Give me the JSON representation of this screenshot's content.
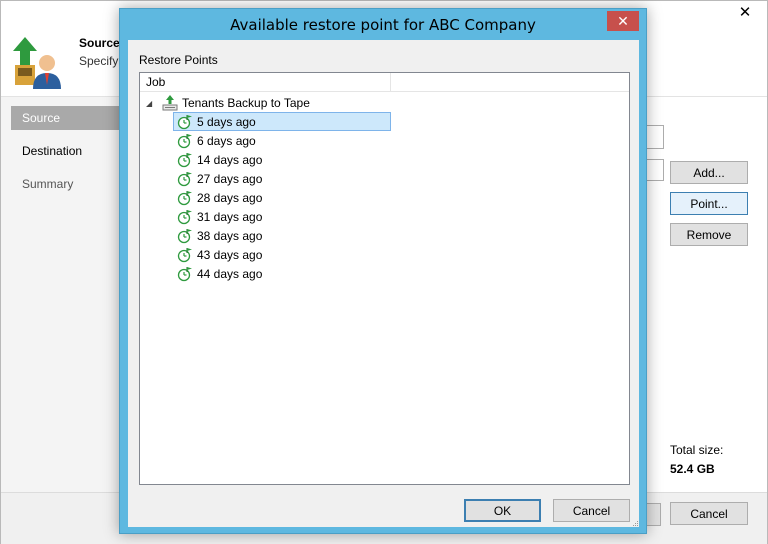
{
  "background": {
    "header_title": "Source",
    "header_subtitle": "Specify",
    "nav": [
      {
        "label": "Source",
        "state": "active"
      },
      {
        "label": "Destination",
        "state": "normal"
      },
      {
        "label": "Summary",
        "state": "dim"
      }
    ],
    "buttons": {
      "add": "Add...",
      "point": "Point...",
      "remove": "Remove",
      "cancel": "Cancel"
    },
    "total_size_label": "Total size:",
    "total_size_value": "52.4 GB",
    "close_glyph": "✕"
  },
  "dialog": {
    "title": "Available restore point for ABC Company",
    "close_glyph": "✕",
    "section_label": "Restore Points",
    "column_job": "Job",
    "job_name": "Tenants Backup to Tape",
    "restore_points": [
      {
        "label": "5 days ago",
        "selected": true
      },
      {
        "label": "6 days ago"
      },
      {
        "label": "14 days ago"
      },
      {
        "label": "27 days ago"
      },
      {
        "label": "28 days ago"
      },
      {
        "label": "31 days ago"
      },
      {
        "label": "38 days ago"
      },
      {
        "label": "43 days ago"
      },
      {
        "label": "44 days ago"
      }
    ],
    "ok_label": "OK",
    "cancel_label": "Cancel"
  },
  "colors": {
    "dialog_frame": "#5eb8e0",
    "close_button": "#c7504c",
    "selection": "#cde8fb",
    "restore_point_icon": "#2e9a3e"
  },
  "icons": {
    "header": "restore-wizard-icon",
    "job": "tape-job-icon",
    "restore_point": "restore-point-clock-icon"
  }
}
